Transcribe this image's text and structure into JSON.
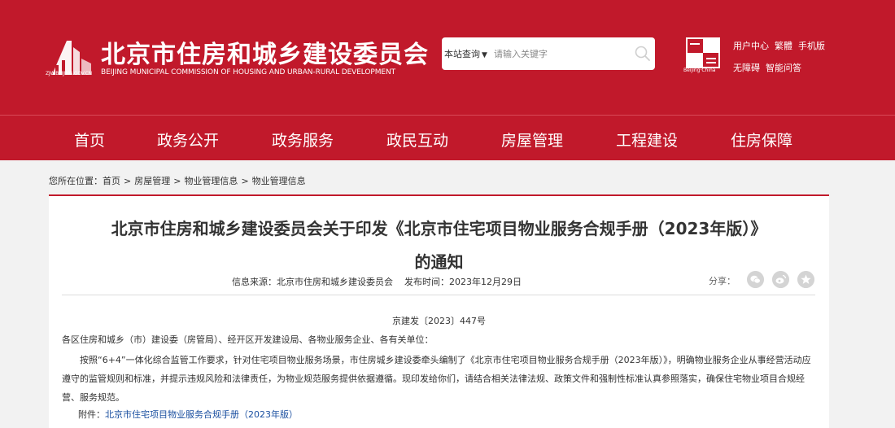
{
  "header": {
    "site_title": "北京市住房和城乡建设委员会",
    "site_subtitle": "BEIJING MUNICIPAL COMMISSION OF HOUSING AND URBAN-RURAL DEVELOPMENT",
    "logo_domain": "ZJW.BEIJING.GOV.CN",
    "capital_caption": "Beijing·China",
    "search": {
      "scope": "本站查询",
      "placeholder": "请输入关键字"
    },
    "links_row1": [
      "用户中心",
      "繁體",
      "手机版"
    ],
    "links_row2": [
      "无障碍",
      "智能问答"
    ],
    "brand_color": "#c1192b"
  },
  "nav": {
    "items": [
      "首页",
      "政务公开",
      "政务服务",
      "政民互动",
      "房屋管理",
      "工程建设",
      "住房保障"
    ]
  },
  "breadcrumb": {
    "prefix": "您所在位置：",
    "items": [
      "首页",
      "房屋管理",
      "物业管理信息",
      "物业管理信息"
    ]
  },
  "article": {
    "title_line1": "北京市住房和城乡建设委员会关于印发《北京市住宅项目物业服务合规手册（2023年版）》",
    "title_line2": "的通知",
    "source_label": "信息来源：",
    "source": "北京市住房和城乡建设委员会",
    "date_label": "发布时间：",
    "date": "2023年12月29日",
    "share_label": "分享：",
    "share_icons": [
      "wechat-icon",
      "weibo-icon",
      "star-icon"
    ],
    "doc_number": "京建发〔2023〕447号",
    "addressee": "各区住房和城乡（市）建设委（房管局）、经开区开发建设局、各物业服务企业、各有关单位：",
    "body": "按照“6+4”一体化综合监管工作要求，针对住宅项目物业服务场景，市住房城乡建设委牵头编制了《北京市住宅项目物业服务合规手册（2023年版）》，明确物业服务企业从事经营活动应遵守的监管规则和标准，并提示违规风险和法律责任，为物业规范服务提供依据遵循。现印发给你们，请结合相关法律法规、政策文件和强制性标准认真参照落实，确保住宅物业项目合规经营、服务规范。",
    "attachment_label": "附件：",
    "attachment_link": "北京市住宅项目物业服务合规手册（2023年版）"
  }
}
